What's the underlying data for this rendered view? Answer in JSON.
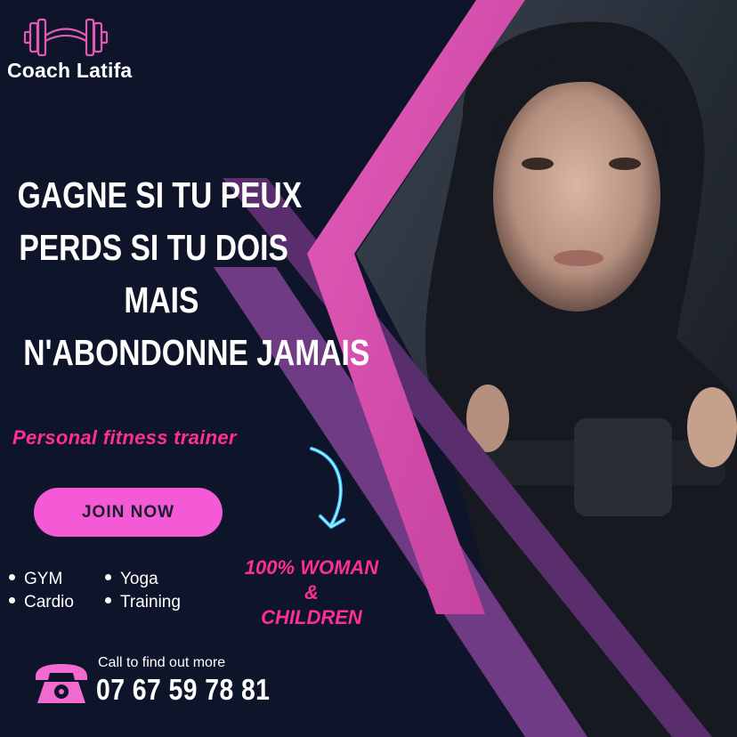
{
  "brand": {
    "name": "Coach Latifa",
    "logo_icon": "dumbbell-icon"
  },
  "headline": {
    "line1": "GAGNE SI TU PEUX",
    "line2": "PERDS SI TU DOIS",
    "line3": "MAIS",
    "line4": "N'ABONDONNE JAMAIS"
  },
  "subtitle": "Personal fitness trainer",
  "cta": {
    "label": "JOIN NOW"
  },
  "services": [
    "GYM",
    "Yoga",
    "Cardio",
    "Training"
  ],
  "audience": {
    "line1": "100% WOMAN",
    "line2": "&",
    "line3": "CHILDREN"
  },
  "contact": {
    "caption": "Call to find out more",
    "phone": "07 67 59 78 81",
    "icon": "telephone-icon"
  },
  "colors": {
    "background": "#0e1429",
    "accent_pink": "#ff2e97",
    "button_pink": "#f45ad6",
    "stripe_purple": "#7a3f8f",
    "neon_blue": "#36c8ff"
  }
}
